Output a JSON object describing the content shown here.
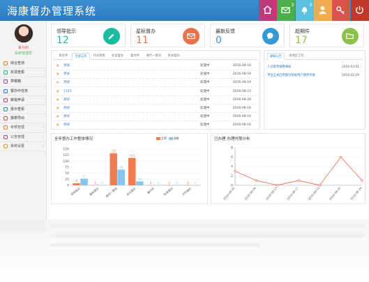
{
  "app": {
    "title": "海康督办管理系统"
  },
  "header_buttons": [
    {
      "name": "home-button",
      "icon": "home-icon",
      "color": "#c0397b"
    },
    {
      "name": "messages-button",
      "icon": "mail-icon",
      "color": "#4cae4c",
      "badge": "3"
    },
    {
      "name": "notifications-button",
      "icon": "bell-icon",
      "color": "#5bc0de",
      "badge": "9"
    },
    {
      "name": "user-button",
      "icon": "user-icon",
      "color": "#f0ad4e"
    },
    {
      "name": "settings-button",
      "icon": "key-icon",
      "color": "#d9534f"
    },
    {
      "name": "logout-button",
      "icon": "power-icon",
      "color": "#c0392b"
    }
  ],
  "user": {
    "name": "鲁为利",
    "role": "系统管理员"
  },
  "sidebar": {
    "items": [
      {
        "label": "综合查询",
        "icon": "search-icon",
        "color": "#e67e22"
      },
      {
        "label": "反馈查看",
        "icon": "search-icon",
        "color": "#27ae60"
      },
      {
        "label": "草稿箱",
        "icon": "document-icon",
        "color": "#8e44ad"
      },
      {
        "label": "督办中任务",
        "icon": "forward-icon",
        "color": "#2c7ac0"
      },
      {
        "label": "审批申请",
        "icon": "check-icon",
        "color": "#c0397b"
      },
      {
        "label": "批示查看",
        "icon": "list-icon",
        "color": "#16a085"
      },
      {
        "label": "报表导出",
        "icon": "edit-icon",
        "color": "#e74c3c"
      },
      {
        "label": "考核管理",
        "icon": "chart-icon",
        "color": "#e67e22",
        "arrow": "›"
      },
      {
        "label": "公告管理",
        "icon": "comment-icon",
        "color": "#c0397b",
        "arrow": "›"
      },
      {
        "label": "系统设置",
        "icon": "gear-icon",
        "color": "#d4a017",
        "arrow": "›"
      }
    ]
  },
  "cards": [
    {
      "title": "领导批示",
      "value": "12",
      "color": "#1abc9c",
      "icon": "pen-icon"
    },
    {
      "title": "星标督办",
      "value": "11",
      "color": "#e8734a",
      "icon": "mail-icon"
    },
    {
      "title": "最新反馈",
      "value": "0",
      "color": "#3498db",
      "icon": "chat-icon"
    },
    {
      "title": "超期件",
      "value": "17",
      "color": "#8bc34a",
      "icon": "folder-icon"
    }
  ],
  "tasks": {
    "tabs": [
      "星标件",
      "全部工作",
      "待办审批",
      "会议督办",
      "督办件",
      "两代一委员",
      "目录督办"
    ],
    "active_tab": 1,
    "rows": [
      {
        "name": "测试",
        "status": "处理中",
        "date": "2016-08-16"
      },
      {
        "name": "测试",
        "status": "处理中",
        "date": "2016-08-18"
      },
      {
        "name": "测试",
        "status": "处理中",
        "date": "2016-08-19"
      },
      {
        "name": "1323",
        "status": "处理中",
        "date": "2016-08-23"
      },
      {
        "name": "测试",
        "status": "处理中",
        "date": "2016-08-28"
      },
      {
        "name": "测试",
        "status": "处理中",
        "date": "2016-08-16"
      },
      {
        "name": "测试",
        "status": "处理中",
        "date": "2016-08-16"
      },
      {
        "name": "测试",
        "status": "处理中",
        "date": "2016-08-16"
      }
    ]
  },
  "notices": {
    "tabs": [
      "通知公告",
      "本地区工作"
    ],
    "active_tab": 0,
    "rows": [
      {
        "title": "人员职责调整通知",
        "date": "2016-03-01"
      },
      {
        "title": "平台正式启用督办系统用户使用手册",
        "date": "2016-02-29"
      }
    ]
  },
  "colors": {
    "primary": "#2c7ac0",
    "orange": "#f07c4f",
    "light_blue": "#87c4f0"
  },
  "chart_data": [
    {
      "type": "bar",
      "title": "全年督办工作整体情况",
      "categories": [
        "领导批示",
        "星标督办",
        "两代一委员",
        "会议督办",
        "督办件",
        "目录督办",
        "文件督办"
      ],
      "series": [
        {
          "name": "立项",
          "color": "#f07c4f",
          "values": [
            8,
            1,
            132,
            113,
            0,
            0,
            0
          ]
        },
        {
          "name": "办结",
          "color": "#87c4f0",
          "values": [
            27,
            0,
            65,
            16,
            0,
            0,
            0
          ]
        }
      ],
      "ylim": [
        0,
        150
      ],
      "yticks": [
        0,
        25,
        50,
        75,
        100,
        125,
        150
      ]
    },
    {
      "type": "line",
      "title": "已办理 办理时限分布",
      "x": [
        "2016-08-05",
        "2016-08-09",
        "2016-08-13",
        "2016-08-17",
        "2016-08-21",
        "2016-08-25",
        "2016-08-29"
      ],
      "series": [
        {
          "name": "已办理",
          "color": "#e8735a",
          "values": [
            3,
            1,
            0,
            1,
            0,
            6,
            1
          ]
        }
      ],
      "ylim": [
        0,
        8
      ],
      "yticks": [
        0,
        2,
        4,
        6,
        8
      ]
    }
  ]
}
